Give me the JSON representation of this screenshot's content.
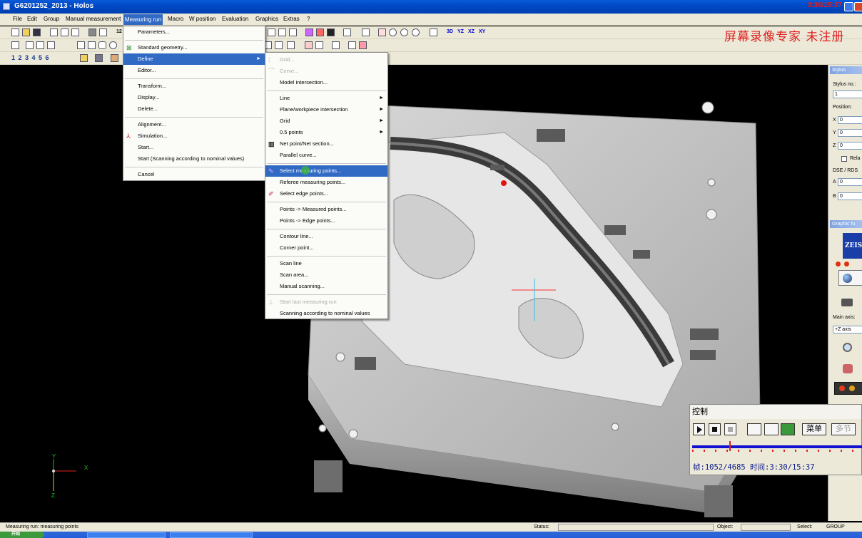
{
  "window": {
    "title": "G6201252_2013 - Holos",
    "clock_overlay": "3:30/15:37"
  },
  "watermark": "屏幕录像专家  未注册",
  "menubar": [
    {
      "label": "File"
    },
    {
      "label": "Edit"
    },
    {
      "label": "Group"
    },
    {
      "label": "Manual measurement"
    },
    {
      "label": "Measuring run"
    },
    {
      "label": "Macro"
    },
    {
      "label": "W position"
    },
    {
      "label": "Evaluation"
    },
    {
      "label": "Graphics"
    },
    {
      "label": "Extras"
    },
    {
      "label": "?"
    }
  ],
  "toolbar": {
    "view_3d": "3D",
    "view_yz": "YZ",
    "view_xz": "XZ",
    "view_xy": "XY",
    "field_12": "12",
    "nums": "1 2 3 4 5 6"
  },
  "measuring_run_menu": [
    {
      "label": "Parameters...",
      "type": "item"
    },
    {
      "type": "sep"
    },
    {
      "label": "Standard geometry...",
      "type": "item",
      "icon": "geometry-icon"
    },
    {
      "label": "Define",
      "type": "item",
      "submenu": true,
      "highlighted": true
    },
    {
      "label": "Editor...",
      "type": "item"
    },
    {
      "type": "sep"
    },
    {
      "label": "Transform...",
      "type": "item"
    },
    {
      "label": "Display...",
      "type": "item"
    },
    {
      "label": "Delete...",
      "type": "item"
    },
    {
      "type": "sep"
    },
    {
      "label": "Alignment...",
      "type": "item"
    },
    {
      "label": "Simulation...",
      "type": "item",
      "icon": "simulation-icon"
    },
    {
      "label": "Start...",
      "type": "item"
    },
    {
      "label": "Start (Scanning according to nominal values)",
      "type": "item"
    },
    {
      "type": "sep"
    },
    {
      "label": "Cancel",
      "type": "item"
    }
  ],
  "define_submenu": [
    {
      "label": "Grid...",
      "type": "item",
      "disabled": true
    },
    {
      "label": "Curve...",
      "type": "item",
      "disabled": true
    },
    {
      "label": "Model intersection...",
      "type": "item"
    },
    {
      "type": "sep"
    },
    {
      "label": "Line",
      "type": "item",
      "submenu": true
    },
    {
      "label": "Plane/workpiece intersection",
      "type": "item",
      "submenu": true
    },
    {
      "label": "Grid",
      "type": "item",
      "submenu": true
    },
    {
      "label": "0.5 points",
      "type": "item",
      "submenu": true
    },
    {
      "label": "Net point/Net section...",
      "type": "item",
      "icon": "net-icon"
    },
    {
      "label": "Parallel curve...",
      "type": "item"
    },
    {
      "type": "sep"
    },
    {
      "label": "Select measuring points...",
      "type": "item",
      "highlighted": true,
      "icon": "select-points-icon"
    },
    {
      "label": "Referee measuring points...",
      "type": "item"
    },
    {
      "label": "Select edge points...",
      "type": "item",
      "icon": "edge-icon"
    },
    {
      "type": "sep"
    },
    {
      "label": "Points -> Measured points...",
      "type": "item"
    },
    {
      "label": "Points -> Edge points...",
      "type": "item"
    },
    {
      "type": "sep"
    },
    {
      "label": "Contour line...",
      "type": "item"
    },
    {
      "label": "Corner point...",
      "type": "item"
    },
    {
      "type": "sep"
    },
    {
      "label": "Scan line",
      "type": "item"
    },
    {
      "label": "Scan area...",
      "type": "item"
    },
    {
      "label": "Manual scanning...",
      "type": "item"
    },
    {
      "type": "sep"
    },
    {
      "label": "Start last measuring run",
      "type": "item",
      "disabled": true,
      "icon": "start-run-icon"
    },
    {
      "label": "Scanning according to nominal values",
      "type": "item"
    }
  ],
  "stylus_panel": {
    "header": "Stylus",
    "stylus_no_label": "Stylus no.:",
    "stylus_no_value": "1",
    "position_label": "Position:",
    "x_label": "X",
    "x_value": "0",
    "y_label": "Y",
    "y_value": "0",
    "z_label": "Z",
    "z_value": "0",
    "relative_label": "Rela",
    "dse_label": "DSE / RDS",
    "a_label": "A",
    "a_value": "0",
    "b_label": "B",
    "b_value": "0"
  },
  "graphic_panel": {
    "header": "Graphic fu",
    "logo": "ZEIS",
    "main_axis_label": "Main axis:",
    "main_axis_value": "+Z axis"
  },
  "video_control": {
    "title": "控制",
    "menu_button": "菜单",
    "multi_button": "多节",
    "status_text": "帧:1052/4685 时间:3:30/15:37",
    "progress": 0.22
  },
  "axes": {
    "x": "X",
    "y": "Y",
    "z": "Z"
  },
  "statusbar": {
    "message": "Measuring run: measuring points",
    "status_label": "Status:",
    "object_label": "Object:",
    "select_label": "Select:",
    "select_value": "GROUP"
  },
  "taskbar": {
    "start": "开始"
  },
  "colors": {
    "menu_highlight": "#316ac5",
    "titlebar": "#0049c7",
    "watermark": "#e02020",
    "video_text": "#0a1a8c"
  }
}
